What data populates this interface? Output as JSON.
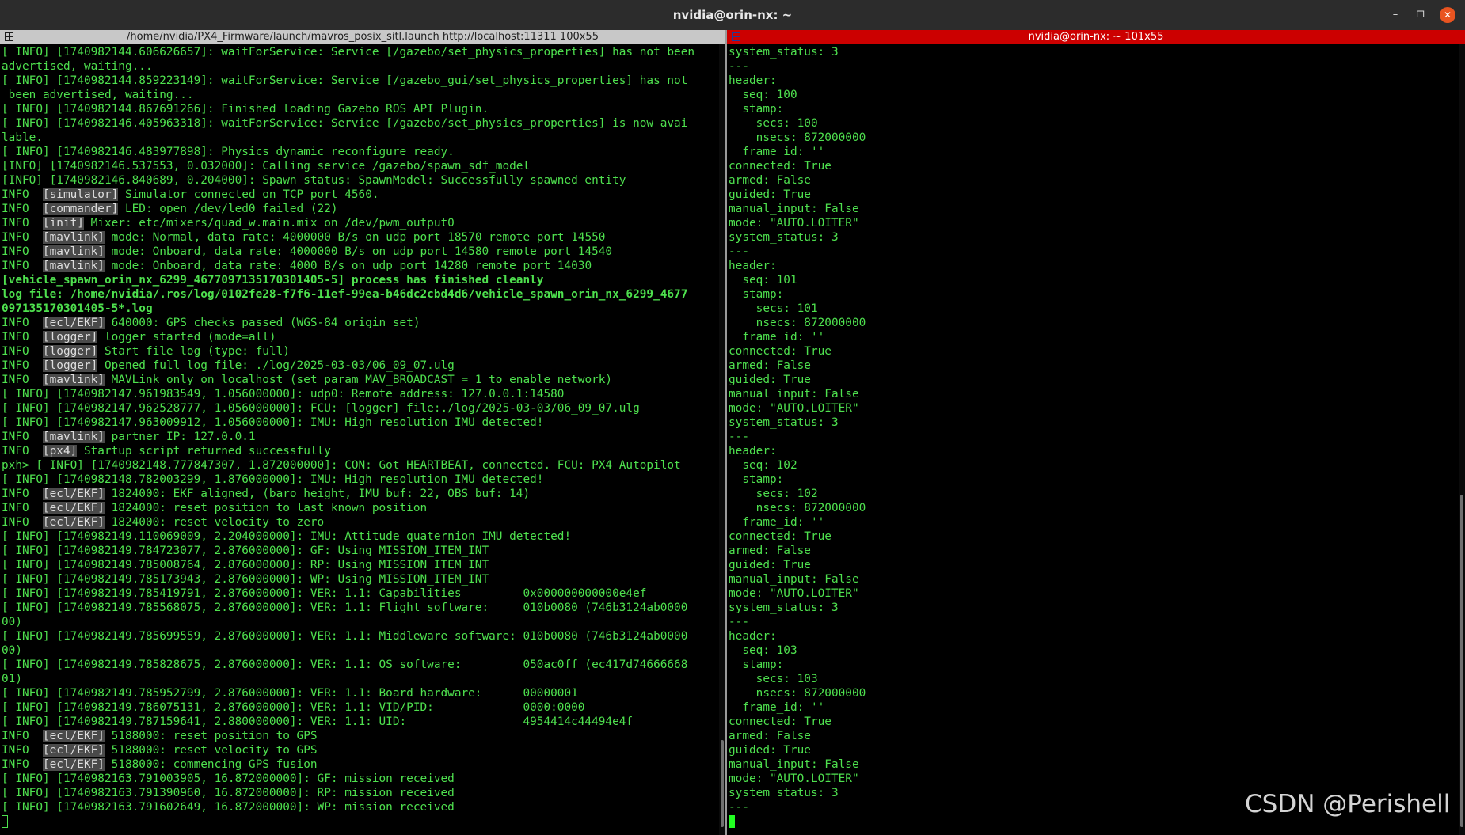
{
  "window": {
    "title": "nvidia@orin-nx: ~",
    "minimize": "–",
    "maximize": "❐",
    "close": "✕"
  },
  "left_pane": {
    "title": "/home/nvidia/PX4_Firmware/launch/mavros_posix_sitl.launch http://localhost:11311 100x55",
    "lines": [
      {
        "t": "[ INFO] [1740982144.606626657]: waitForService: Service [/gazebo/set_physics_properties] has not been"
      },
      {
        "t": "advertised, waiting..."
      },
      {
        "t": "[ INFO] [1740982144.859223149]: waitForService: Service [/gazebo_gui/set_physics_properties] has not"
      },
      {
        "t": " been advertised, waiting..."
      },
      {
        "t": "[ INFO] [1740982144.867691266]: Finished loading Gazebo ROS API Plugin."
      },
      {
        "t": "[ INFO] [1740982146.405963318]: waitForService: Service [/gazebo/set_physics_properties] is now avai"
      },
      {
        "t": "lable."
      },
      {
        "t": "[ INFO] [1740982146.483977898]: Physics dynamic reconfigure ready."
      },
      {
        "t": "[INFO] [1740982146.537553, 0.032000]: Calling service /gazebo/spawn_sdf_model"
      },
      {
        "t": "[INFO] [1740982146.840689, 0.204000]: Spawn status: SpawnModel: Successfully spawned entity"
      },
      {
        "p": "INFO  ",
        "h": "[simulator]",
        "t": " Simulator connected on TCP port 4560."
      },
      {
        "p": "INFO  ",
        "h": "[commander]",
        "t": " LED: open /dev/led0 failed (22)"
      },
      {
        "p": "INFO  ",
        "h": "[init]",
        "t": " Mixer: etc/mixers/quad_w.main.mix on /dev/pwm_output0"
      },
      {
        "p": "INFO  ",
        "h": "[mavlink]",
        "t": " mode: Normal, data rate: 4000000 B/s on udp port 18570 remote port 14550"
      },
      {
        "p": "INFO  ",
        "h": "[mavlink]",
        "t": " mode: Onboard, data rate: 4000000 B/s on udp port 14580 remote port 14540"
      },
      {
        "p": "INFO  ",
        "h": "[mavlink]",
        "t": " mode: Onboard, data rate: 4000 B/s on udp port 14280 remote port 14030"
      },
      {
        "t": "[vehicle_spawn_orin_nx_6299_4677097135170301405-5] process has finished cleanly",
        "b": true
      },
      {
        "t": "log file: /home/nvidia/.ros/log/0102fe28-f7f6-11ef-99ea-b46dc2cbd4d6/vehicle_spawn_orin_nx_6299_4677",
        "b": true
      },
      {
        "t": "097135170301405-5*.log",
        "b": true
      },
      {
        "p": "INFO  ",
        "h": "[ecl/EKF]",
        "t": " 640000: GPS checks passed (WGS-84 origin set)"
      },
      {
        "p": "INFO  ",
        "h": "[logger]",
        "t": " logger started (mode=all)"
      },
      {
        "p": "INFO  ",
        "h": "[logger]",
        "t": " Start file log (type: full)"
      },
      {
        "p": "INFO  ",
        "h": "[logger]",
        "t": " Opened full log file: ./log/2025-03-03/06_09_07.ulg"
      },
      {
        "p": "INFO  ",
        "h": "[mavlink]",
        "t": " MAVLink only on localhost (set param MAV_BROADCAST = 1 to enable network)"
      },
      {
        "t": "[ INFO] [1740982147.961983549, 1.056000000]: udp0: Remote address: 127.0.0.1:14580"
      },
      {
        "t": "[ INFO] [1740982147.962528777, 1.056000000]: FCU: [logger] file:./log/2025-03-03/06_09_07.ulg"
      },
      {
        "t": "[ INFO] [1740982147.963009912, 1.056000000]: IMU: High resolution IMU detected!"
      },
      {
        "p": "INFO  ",
        "h": "[mavlink]",
        "t": " partner IP: 127.0.0.1"
      },
      {
        "p": "INFO  ",
        "h": "[px4]",
        "t": " Startup script returned successfully"
      },
      {
        "t": "pxh> [ INFO] [1740982148.777847307, 1.872000000]: CON: Got HEARTBEAT, connected. FCU: PX4 Autopilot"
      },
      {
        "t": "[ INFO] [1740982148.782003299, 1.876000000]: IMU: High resolution IMU detected!"
      },
      {
        "p": "INFO  ",
        "h": "[ecl/EKF]",
        "t": " 1824000: EKF aligned, (baro height, IMU buf: 22, OBS buf: 14)"
      },
      {
        "p": "INFO  ",
        "h": "[ecl/EKF]",
        "t": " 1824000: reset position to last known position"
      },
      {
        "p": "INFO  ",
        "h": "[ecl/EKF]",
        "t": " 1824000: reset velocity to zero"
      },
      {
        "t": "[ INFO] [1740982149.110069009, 2.204000000]: IMU: Attitude quaternion IMU detected!"
      },
      {
        "t": "[ INFO] [1740982149.784723077, 2.876000000]: GF: Using MISSION_ITEM_INT"
      },
      {
        "t": "[ INFO] [1740982149.785008764, 2.876000000]: RP: Using MISSION_ITEM_INT"
      },
      {
        "t": "[ INFO] [1740982149.785173943, 2.876000000]: WP: Using MISSION_ITEM_INT"
      },
      {
        "t": "[ INFO] [1740982149.785419791, 2.876000000]: VER: 1.1: Capabilities         0x000000000000e4ef"
      },
      {
        "t": "[ INFO] [1740982149.785568075, 2.876000000]: VER: 1.1: Flight software:     010b0080 (746b3124ab0000"
      },
      {
        "t": "00)"
      },
      {
        "t": "[ INFO] [1740982149.785699559, 2.876000000]: VER: 1.1: Middleware software: 010b0080 (746b3124ab0000"
      },
      {
        "t": "00)"
      },
      {
        "t": "[ INFO] [1740982149.785828675, 2.876000000]: VER: 1.1: OS software:         050ac0ff (ec417d74666668"
      },
      {
        "t": "01)"
      },
      {
        "t": "[ INFO] [1740982149.785952799, 2.876000000]: VER: 1.1: Board hardware:      00000001"
      },
      {
        "t": "[ INFO] [1740982149.786075131, 2.876000000]: VER: 1.1: VID/PID:             0000:0000"
      },
      {
        "t": "[ INFO] [1740982149.787159641, 2.880000000]: VER: 1.1: UID:                 4954414c44494e4f"
      },
      {
        "p": "INFO  ",
        "h": "[ecl/EKF]",
        "t": " 5188000: reset position to GPS"
      },
      {
        "p": "INFO  ",
        "h": "[ecl/EKF]",
        "t": " 5188000: reset velocity to GPS"
      },
      {
        "p": "INFO  ",
        "h": "[ecl/EKF]",
        "t": " 5188000: commencing GPS fusion"
      },
      {
        "t": "[ INFO] [1740982163.791003905, 16.872000000]: GF: mission received"
      },
      {
        "t": "[ INFO] [1740982163.791390960, 16.872000000]: RP: mission received"
      },
      {
        "t": "[ INFO] [1740982163.791602649, 16.872000000]: WP: mission received"
      }
    ]
  },
  "right_pane": {
    "title": "nvidia@orin-nx: ~ 101x55",
    "head_lines": [
      "system_status: 3",
      "---"
    ],
    "messages": [
      {
        "seq": "101",
        "secs": "100",
        "nsecs": "872000000"
      }
    ],
    "lines": [
      "system_status: 3",
      "---",
      "header:",
      "  seq: 100",
      "  stamp:",
      "    secs: 100",
      "    nsecs: 872000000",
      "  frame_id: ''",
      "connected: True",
      "armed: False",
      "guided: True",
      "manual_input: False",
      "mode: \"AUTO.LOITER\"",
      "system_status: 3",
      "---",
      "header:",
      "  seq: 101",
      "  stamp:",
      "    secs: 101",
      "    nsecs: 872000000",
      "  frame_id: ''",
      "connected: True",
      "armed: False",
      "guided: True",
      "manual_input: False",
      "mode: \"AUTO.LOITER\"",
      "system_status: 3",
      "---",
      "header:",
      "  seq: 102",
      "  stamp:",
      "    secs: 102",
      "    nsecs: 872000000",
      "  frame_id: ''",
      "connected: True",
      "armed: False",
      "guided: True",
      "manual_input: False",
      "mode: \"AUTO.LOITER\"",
      "system_status: 3",
      "---",
      "header:",
      "  seq: 103",
      "  stamp:",
      "    secs: 103",
      "    nsecs: 872000000",
      "  frame_id: ''",
      "connected: True",
      "armed: False",
      "guided: True",
      "manual_input: False",
      "mode: \"AUTO.LOITER\"",
      "system_status: 3",
      "---"
    ]
  },
  "watermark": "CSDN @Perishell",
  "colors": {
    "terminal_text": "#4ee04e",
    "active_header": "#cc0000",
    "inactive_header": "#c8c8c8",
    "background": "#000000"
  }
}
